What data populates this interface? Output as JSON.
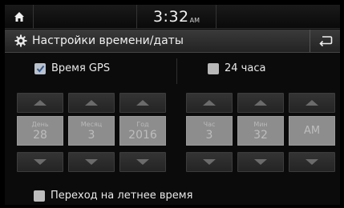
{
  "status": {
    "time": "3:32",
    "ampm": "AM",
    "home_icon": "home-icon"
  },
  "title": {
    "text": "Настройки времени/даты",
    "icon": "gear-icon",
    "back_icon": "back-arrow-icon"
  },
  "options": {
    "gps": {
      "label": "Время GPS",
      "checked": true
    },
    "h24": {
      "label": "24 часа",
      "checked": false
    }
  },
  "date": [
    {
      "label": "День",
      "value": "28"
    },
    {
      "label": "Месяц",
      "value": "3"
    },
    {
      "label": "Год",
      "value": "2016"
    }
  ],
  "time": [
    {
      "label": "Час",
      "value": "3"
    },
    {
      "label": "Мин",
      "value": "32"
    },
    {
      "label": "",
      "value": "AM"
    }
  ],
  "dst": {
    "label": "Переход на летнее время",
    "checked": false
  }
}
